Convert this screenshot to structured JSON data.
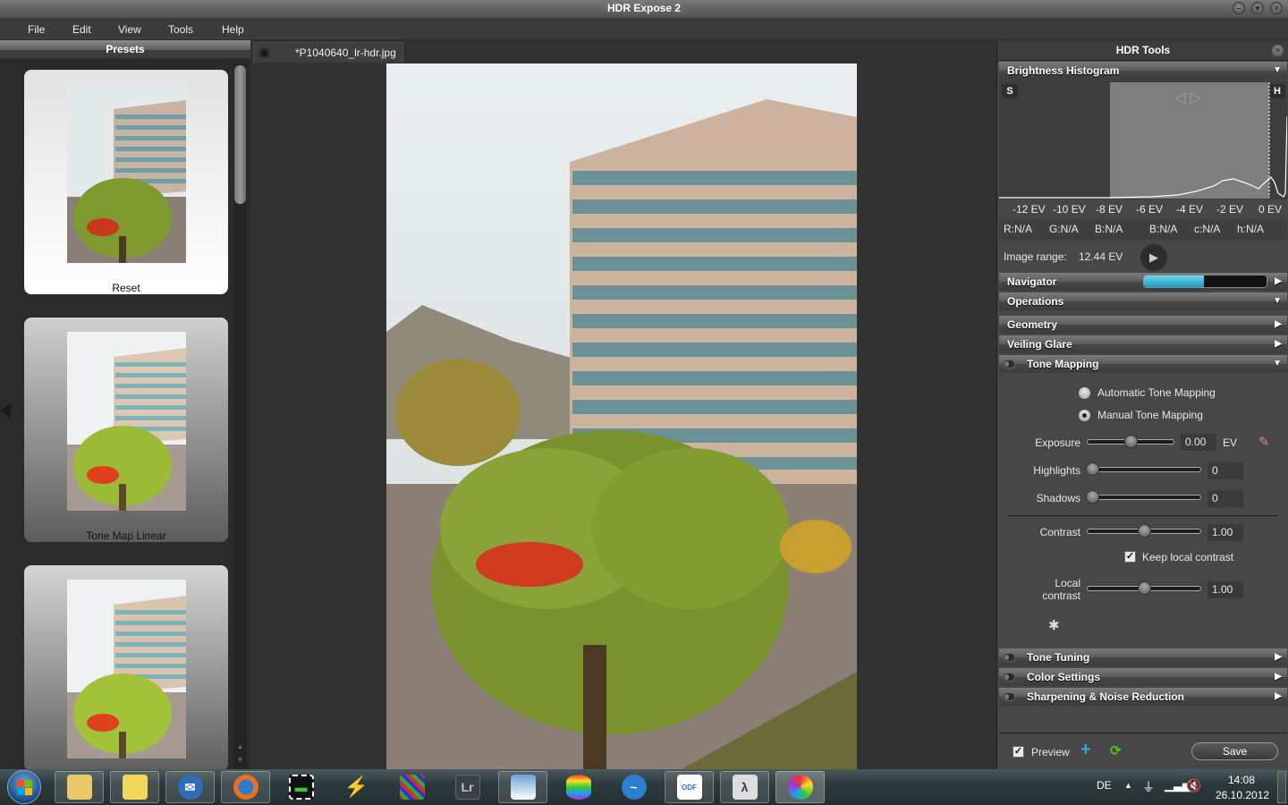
{
  "window": {
    "title": "HDR Expose 2",
    "buttons": [
      "minimize",
      "maximize",
      "close"
    ]
  },
  "menu": [
    "File",
    "Edit",
    "View",
    "Tools",
    "Help"
  ],
  "presets": {
    "title": "Presets",
    "items": [
      {
        "label": "Reset",
        "selected": true
      },
      {
        "label": "Tone Map Linear",
        "selected": false
      },
      {
        "label": "",
        "selected": false
      }
    ]
  },
  "document": {
    "tab_label": "*P1040640_lr-hdr.jpg"
  },
  "hdr_tools": {
    "title": "HDR Tools",
    "histogram": {
      "section": "Brightness Histogram",
      "shadow_badge": "S",
      "highlight_badge": "H",
      "ev_labels": [
        "-12 EV",
        "-10 EV",
        "-8 EV",
        "-6 EV",
        "-4 EV",
        "-2 EV",
        "0 EV"
      ],
      "readouts": [
        "R:N/A",
        "G:N/A",
        "B:N/A",
        "B:N/A",
        "c:N/A",
        "h:N/A"
      ],
      "image_range_label": "Image range:",
      "image_range_value": "12.44 EV"
    },
    "navigator": {
      "label": "Navigator",
      "progress": 0.49
    },
    "operations": {
      "label": "Operations"
    },
    "sections": {
      "geometry": "Geometry",
      "veiling_glare": "Veiling Glare",
      "tone_mapping": "Tone Mapping",
      "tone_tuning": "Tone Tuning",
      "color_settings": "Color Settings",
      "sharpening": "Sharpening & Noise Reduction"
    },
    "tone_mapping": {
      "modes": [
        {
          "label": "Automatic Tone Mapping",
          "selected": false
        },
        {
          "label": "Manual Tone Mapping",
          "selected": true
        }
      ],
      "exposure": {
        "label": "Exposure",
        "value": "0.00",
        "unit": "EV",
        "position": 0.5
      },
      "highlights": {
        "label": "Highlights",
        "value": "0",
        "position": 0.0
      },
      "shadows": {
        "label": "Shadows",
        "value": "0",
        "position": 0.0
      },
      "contrast": {
        "label": "Contrast",
        "value": "1.00",
        "position": 0.5
      },
      "keep_local_contrast": {
        "label": "Keep local contrast",
        "checked": true
      },
      "local_contrast": {
        "label_line1": "Local",
        "label_line2": "contrast",
        "value": "1.00",
        "position": 0.5
      }
    },
    "footer": {
      "preview_label": "Preview",
      "preview_checked": true,
      "save_label": "Save"
    }
  },
  "taskbar": {
    "apps": [
      "Windows Explorer",
      "Sticky Notes",
      "Thunderbird",
      "Firefox",
      "Video Editor",
      "Winamp",
      "PDF Tool",
      "Lightroom",
      "Paint",
      "App",
      "OpenOffice",
      "ODF Document",
      "App",
      "Expose"
    ],
    "tray": {
      "language": "DE",
      "time": "14:08",
      "date": "26.10.2012"
    }
  }
}
